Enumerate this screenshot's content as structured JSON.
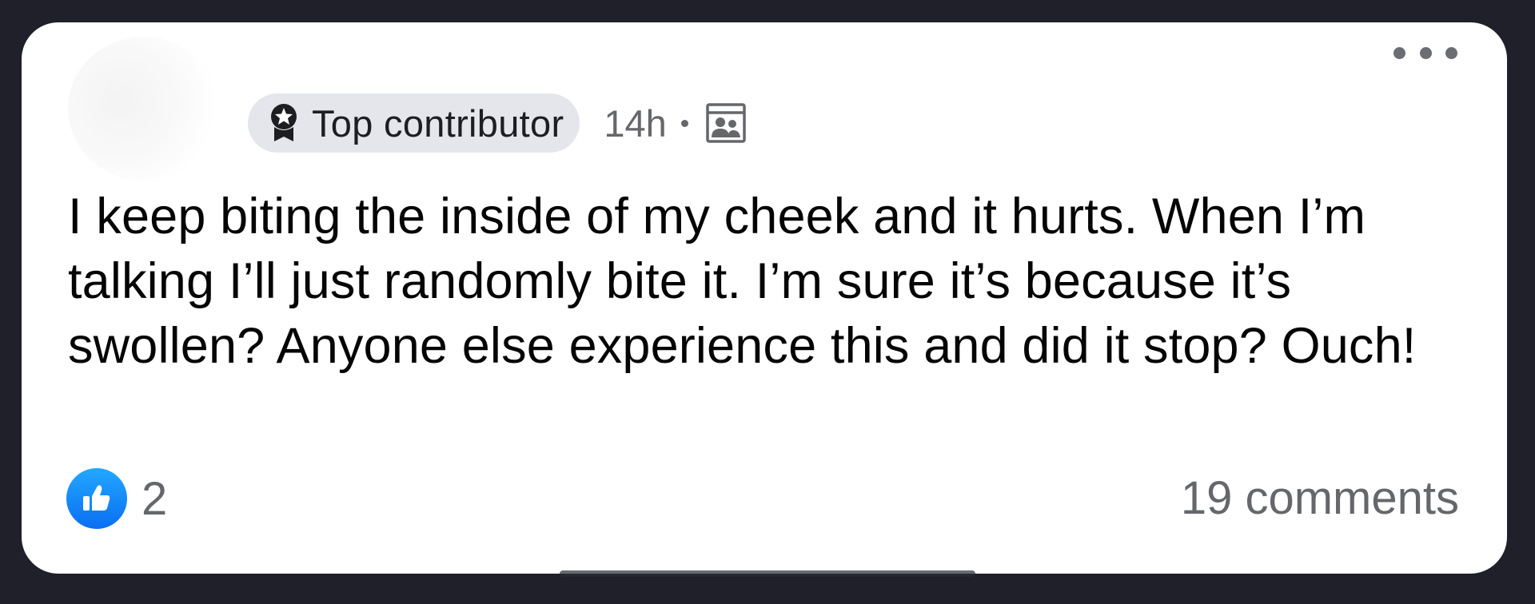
{
  "post": {
    "badge_label": "Top contributor",
    "badge_icon": "top-contributor-icon",
    "time": "14h",
    "audience_icon": "group-icon",
    "text": "I keep biting the inside of my cheek and it hurts. When I’m talking I’ll just randomly bite it. I’m sure it’s because it’s swollen? Anyone else experience this and did it stop? Ouch!",
    "menu_icon": "more-options-icon"
  },
  "footer": {
    "reaction_icon": "like-icon",
    "reaction_count": "2",
    "comments": "19 comments"
  },
  "colors": {
    "background": "#1f2029",
    "card": "#ffffff",
    "badge_bg": "#e4e6eb",
    "secondary_text": "#65676b",
    "like_blue": "#1877f2"
  }
}
